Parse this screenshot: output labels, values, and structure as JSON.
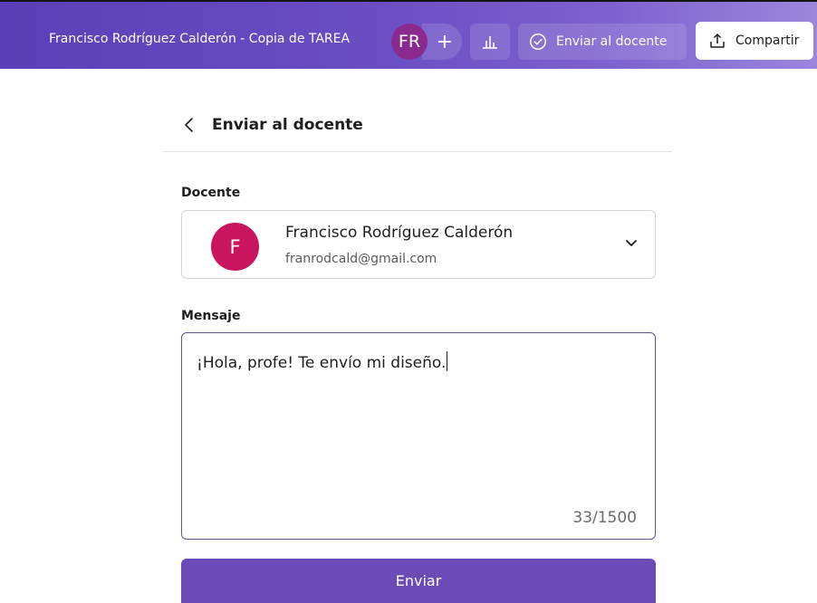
{
  "header": {
    "document_title": "Francisco Rodríguez Calderón - Copia de TAREA",
    "avatar_initials": "FR",
    "add_collaborator_label": "+",
    "stats_icon": "bar-chart-icon",
    "send_to_teacher_label": "Enviar al docente",
    "share_label": "Compartir",
    "colors": {
      "bar_start": "#5a3fb8",
      "bar_end": "#9b86dc",
      "avatar_bg": "#8a2a8f"
    }
  },
  "panel": {
    "title": "Enviar al docente",
    "back_icon": "chevron-left-icon",
    "teacher_label": "Docente",
    "teacher": {
      "initial": "F",
      "name": "Francisco Rodríguez Calderón",
      "email": "franrodcald@gmail.com",
      "avatar_color": "#c8155e"
    },
    "message_label": "Mensaje",
    "message_value": "¡Hola, profe! Te envío mi diseño.",
    "char_count": "33/1500",
    "submit_label": "Enviar",
    "submit_color": "#6b4bb5"
  }
}
